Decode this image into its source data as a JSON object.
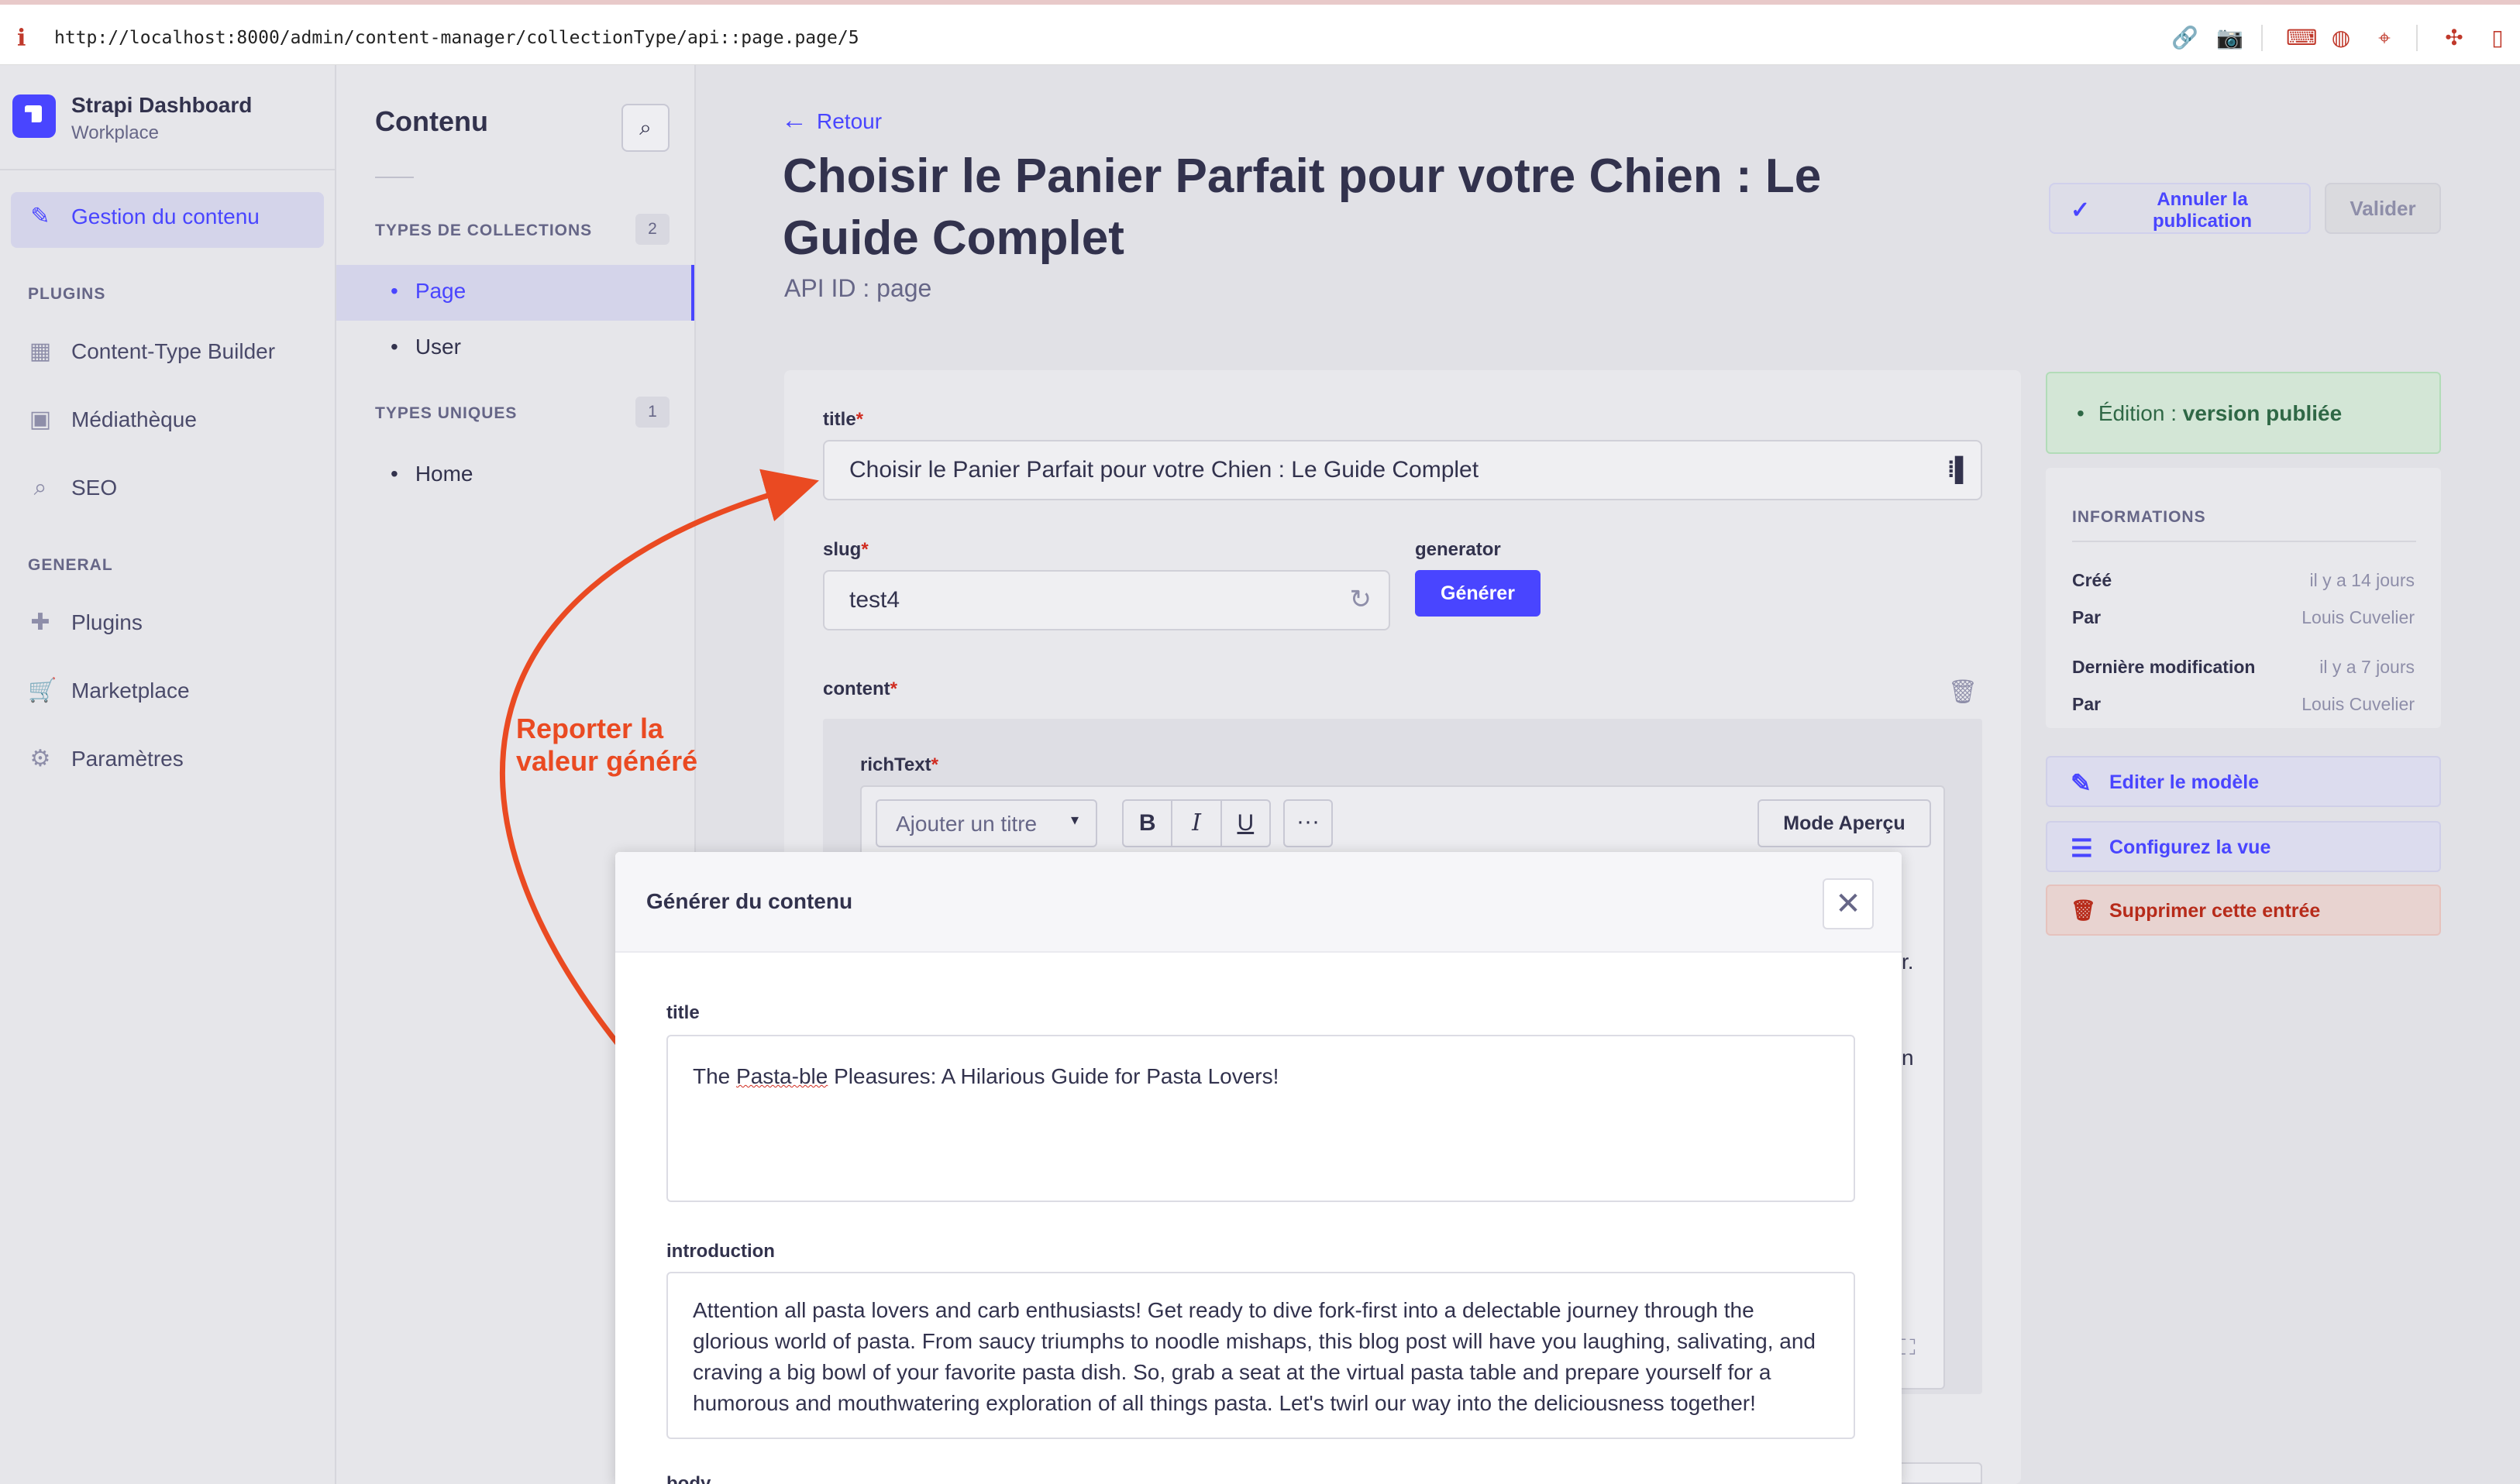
{
  "browser": {
    "url": "http://localhost:8000/admin/content-manager/collectionType/api::page.page/5",
    "info_glyph": "i",
    "toolbar_icons": [
      "link-icon",
      "camera-icon",
      "terminal-icon",
      "globe-icon",
      "crosshair-icon",
      "extension-icon",
      "sidebar-icon"
    ]
  },
  "sidebar": {
    "brand_title": "Strapi Dashboard",
    "brand_subtitle": "Workplace",
    "active_item": "Gestion du contenu",
    "plugins_header": "PLUGINS",
    "plugins": [
      "Content-Type Builder",
      "Médiathèque",
      "SEO"
    ],
    "general_header": "GENERAL",
    "general": [
      "Plugins",
      "Marketplace",
      "Paramètres"
    ]
  },
  "subnav": {
    "title": "Contenu",
    "collections_header": "TYPES DE COLLECTIONS",
    "collections_count": "2",
    "collections": [
      "Page",
      "User"
    ],
    "singles_header": "TYPES UNIQUES",
    "singles_count": "1",
    "singles": [
      "Home"
    ]
  },
  "header": {
    "back_label": "Retour",
    "title": "Choisir le Panier Parfait pour votre Chien : Le Guide Complet",
    "api_id": "API ID : page",
    "unpublish_label": "Annuler la publication",
    "validate_label": "Valider"
  },
  "form": {
    "title_label": "title",
    "title_value": "Choisir le Panier Parfait pour votre Chien : Le Guide Complet",
    "slug_label": "slug",
    "slug_value": "test4",
    "generator_label": "generator",
    "generate_button": "Générer",
    "content_label": "content",
    "richtext_label": "richText",
    "heading_select": "Ajouter un titre",
    "bold": "B",
    "italic": "I",
    "underline": "U",
    "more": "···",
    "preview_button": "Mode Aperçu",
    "peek_1": "r.",
    "peek_2": "n"
  },
  "right_panel": {
    "status_prefix": "Édition : ",
    "status_value": "version publiée",
    "info_header": "INFORMATIONS",
    "created_label": "Créé",
    "created_value": "il y a 14 jours",
    "by_label": "Par",
    "created_by": "Louis Cuvelier",
    "modified_label": "Dernière modification",
    "modified_value": "il y a 7 jours",
    "modified_by_label": "Par",
    "modified_by": "Louis Cuvelier",
    "edit_model": "Editer le modèle",
    "configure_view": "Configurez la vue",
    "delete_entry": "Supprimer cette entrée"
  },
  "annotation": {
    "line1": "Reporter la",
    "line2": "valeur généré",
    "color": "#ea4a22"
  },
  "modal": {
    "title": "Générer du contenu",
    "title_label": "title",
    "title_value_pre": "The ",
    "title_value_squiggle": "Pasta-ble",
    "title_value_post": " Pleasures: A Hilarious Guide for Pasta Lovers!",
    "introduction_label": "introduction",
    "introduction_value": "Attention all pasta lovers and carb enthusiasts! Get ready to dive fork-first into a delectable journey through the glorious world of pasta. From saucy triumphs to noodle mishaps, this blog post will have you laughing, salivating, and craving a big bowl of your favorite pasta dish. So, grab a seat at the virtual pasta table and prepare yourself for a humorous and mouthwatering exploration of all things pasta. Let's twirl our way into the deliciousness together!",
    "cut_label": "body"
  },
  "colors": {
    "accent": "#4945ff",
    "danger": "#d02b20",
    "success": "#2f6846"
  }
}
